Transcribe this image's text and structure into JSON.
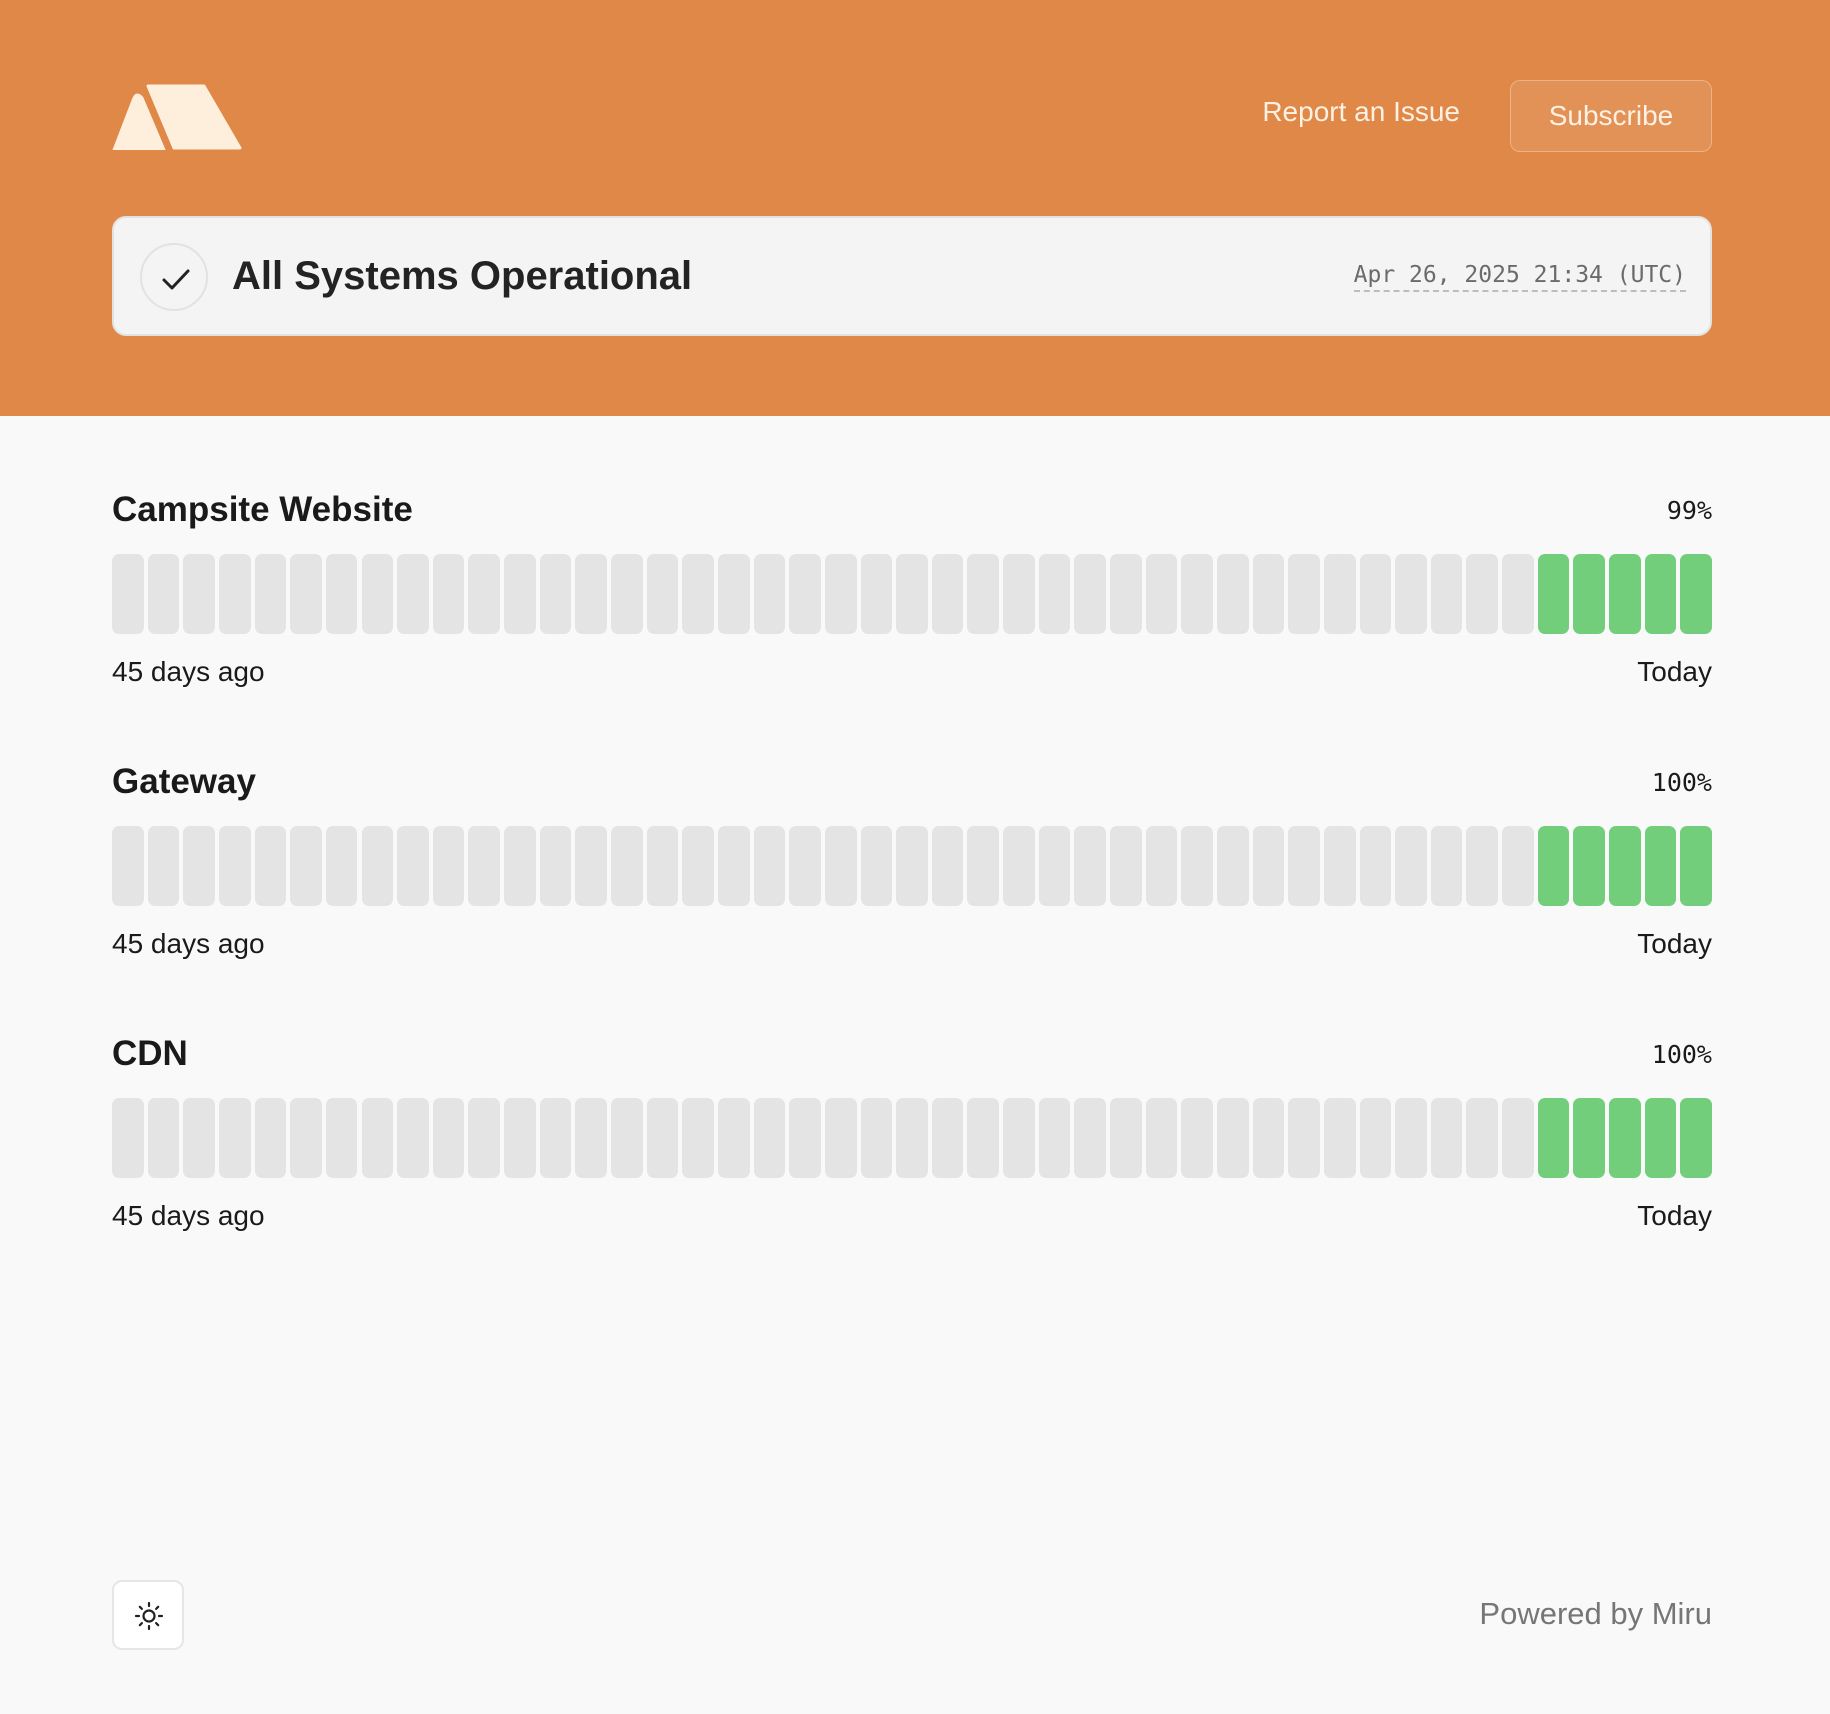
{
  "header": {
    "logo_icon": "mountain-logo-icon",
    "report_label": "Report an Issue",
    "subscribe_label": "Subscribe",
    "accent_color": "#e08847"
  },
  "status": {
    "icon": "check-icon",
    "title": "All Systems Operational",
    "timestamp": "Apr 26, 2025 21:34 (UTC)"
  },
  "monitors": [
    {
      "name": "Campsite Website",
      "uptime": "99%",
      "range_start": "45 days ago",
      "range_end": "Today",
      "days_total": 45,
      "days_with_data": 5
    },
    {
      "name": "Gateway",
      "uptime": "100%",
      "range_start": "45 days ago",
      "range_end": "Today",
      "days_total": 45,
      "days_with_data": 5
    },
    {
      "name": "CDN",
      "uptime": "100%",
      "range_start": "45 days ago",
      "range_end": "Today",
      "days_total": 45,
      "days_with_data": 5
    }
  ],
  "colors": {
    "bar_up": "#72ce7b",
    "bar_empty": "#e4e4e4"
  },
  "footer": {
    "theme_icon": "sun-icon",
    "powered_by": "Powered by Miru"
  }
}
